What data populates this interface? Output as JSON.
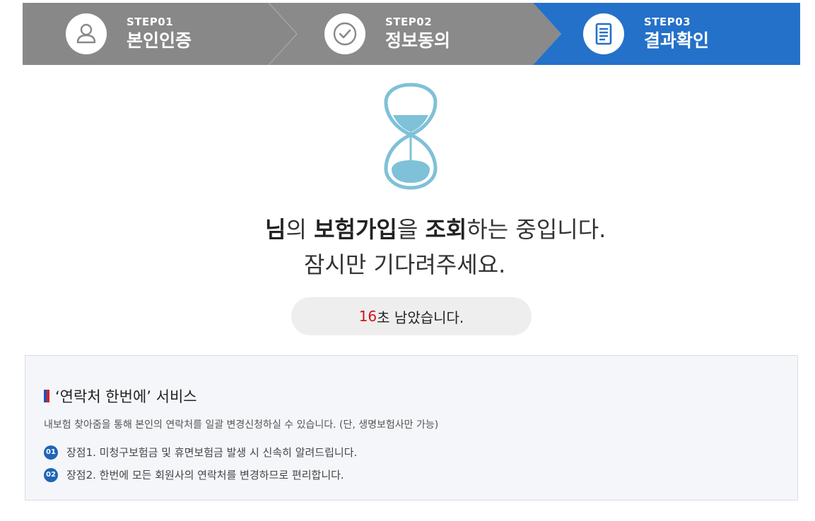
{
  "steps": [
    {
      "num": "STEP01",
      "label": "본인인증",
      "icon": "person-icon",
      "active": false
    },
    {
      "num": "STEP02",
      "label": "정보동의",
      "icon": "check-circle-icon",
      "active": false
    },
    {
      "num": "STEP03",
      "label": "결과확인",
      "icon": "document-icon",
      "active": true
    }
  ],
  "colors": {
    "step_inactive": "#888888",
    "step_active": "#2471c9",
    "hourglass": "#7ec1d8",
    "countdown_number": "#d0121b",
    "badge": "#1f64b8"
  },
  "message": {
    "line1_part1": "님",
    "line1_part2": "의 ",
    "line1_part3": "보험가입",
    "line1_part4": "을 ",
    "line1_part5": "조회",
    "line1_part6": "하는 중입니다.",
    "line2": "잠시만 기다려주세요."
  },
  "countdown": {
    "seconds": "16",
    "suffix": "초 남았습니다."
  },
  "service": {
    "title": "‘연락처 한번에’ 서비스",
    "description": "내보험 찾아줌을 통해 본인의 연락처를 일괄 변경신청하실 수 있습니다. (단, 생명보험사만 가능)",
    "items": [
      {
        "badge": "01",
        "text": "장점1. 미청구보험금 및 휴면보험금 발생 시 신속히 알려드립니다."
      },
      {
        "badge": "02",
        "text": "장점2. 한번에 모든 회원사의 연락처를 변경하므로 편리합니다."
      }
    ]
  }
}
